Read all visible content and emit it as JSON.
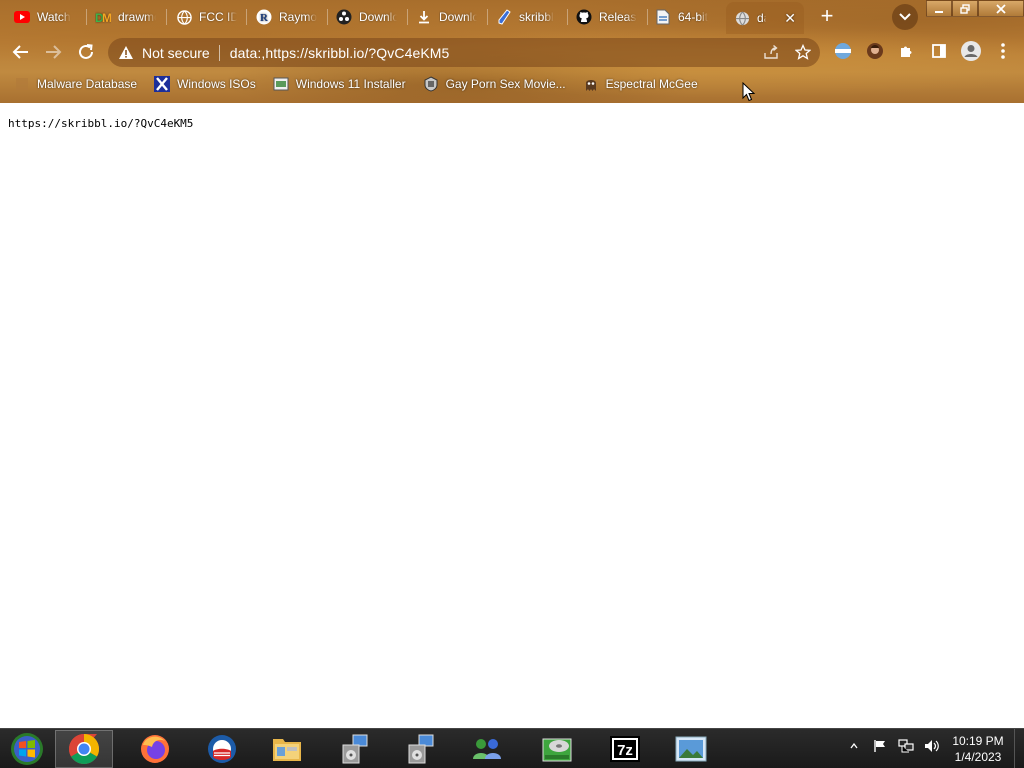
{
  "browser": {
    "tabs": [
      {
        "label": "Watch",
        "icon": "youtube-icon"
      },
      {
        "label": "drawmo",
        "icon": "drawmore-icon"
      },
      {
        "label": "FCC ID",
        "icon": "globe-icon"
      },
      {
        "label": "Raymon",
        "icon": "r-logo-icon"
      },
      {
        "label": "Downloa",
        "icon": "obs-icon"
      },
      {
        "label": "Downloa",
        "icon": "download-icon"
      },
      {
        "label": "skribbl",
        "icon": "pencil-icon"
      },
      {
        "label": "Release",
        "icon": "github-icon"
      },
      {
        "label": "64-bit",
        "icon": "document-icon"
      },
      {
        "label": "dat",
        "icon": "globe-icon"
      }
    ],
    "active_tab_close": "✕",
    "new_tab": "+",
    "omnibox": {
      "security_label": "Not secure",
      "url": "data:,https://skribbl.io/?QvC4eKM5"
    },
    "bookmarks": [
      {
        "label": "Malware Database",
        "icon": "malware-database-icon"
      },
      {
        "label": "Windows ISOs",
        "icon": "x-icon"
      },
      {
        "label": "Windows 11 Installer",
        "icon": "installer-icon"
      },
      {
        "label": "Gay Porn Sex Movie...",
        "icon": "bookmark-site-icon"
      },
      {
        "label": "Espectral McGee",
        "icon": "ghost-icon"
      }
    ]
  },
  "page": {
    "text": "https://skribbl.io/?QvC4eKM5"
  },
  "taskbar": {
    "apps": [
      {
        "name": "chrome",
        "icon": "chrome-icon"
      },
      {
        "name": "firefox",
        "icon": "firefox-icon"
      },
      {
        "name": "obama",
        "icon": "obama-logo-icon"
      },
      {
        "name": "explorer",
        "icon": "folder-icon"
      },
      {
        "name": "installer-1",
        "icon": "setup-icon"
      },
      {
        "name": "installer-2",
        "icon": "setup-icon"
      },
      {
        "name": "network",
        "icon": "network-people-icon"
      },
      {
        "name": "disk",
        "icon": "disk-icon"
      },
      {
        "name": "7zip",
        "icon": "7zip-icon",
        "label": "7z"
      },
      {
        "name": "photos",
        "icon": "photo-viewer-icon"
      }
    ],
    "clock": {
      "time": "10:19 PM",
      "date": "1/4/2023"
    }
  }
}
